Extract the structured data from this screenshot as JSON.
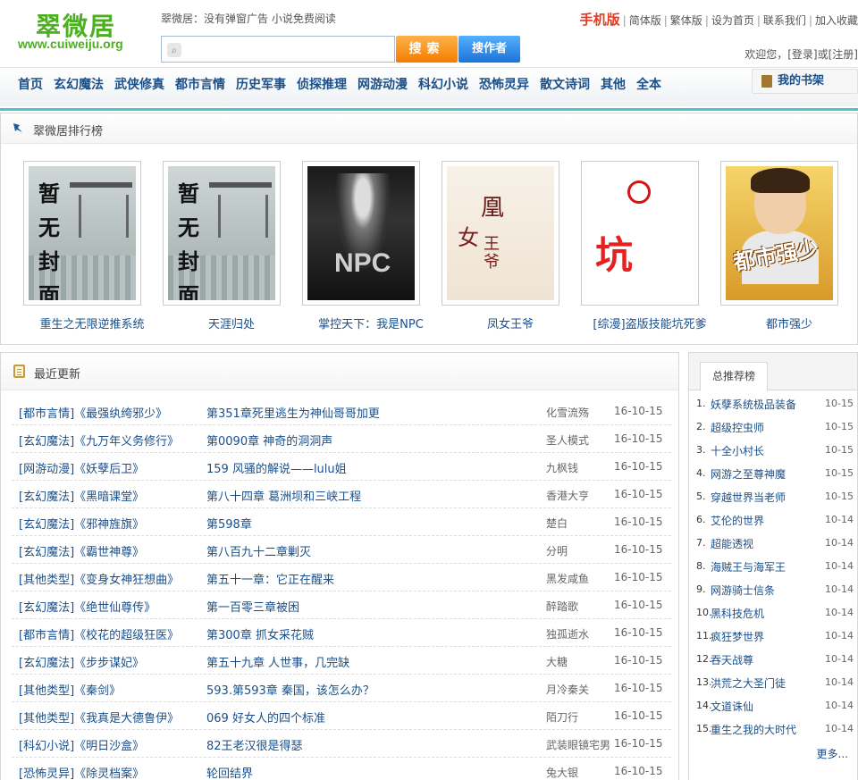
{
  "header": {
    "logo_cn": "翠微居",
    "logo_en": "www.cuiweiju.org",
    "slogan": "翠微居：没有弹窗广告 小说免费阅读",
    "search_placeholder": "",
    "search_button": "搜索",
    "author_button": "搜作者",
    "top_links": {
      "mobile": "手机版",
      "simplified": "简体版",
      "traditional": "繁体版",
      "homepage": "设为首页",
      "contact": "联系我们",
      "favorite": "加入收藏"
    },
    "welcome": "欢迎您，",
    "login": "[登录]",
    "or": "或",
    "register": "[注册]"
  },
  "nav": {
    "items": [
      "首页",
      "玄幻魔法",
      "武侠修真",
      "都市言情",
      "历史军事",
      "侦探推理",
      "网游动漫",
      "科幻小说",
      "恐怖灵异",
      "散文诗词",
      "其他",
      "全本"
    ],
    "shelf": "我的书架"
  },
  "ranking": {
    "title": "翠微居排行榜",
    "books": [
      {
        "name": "重生之无限逆推系统",
        "cover": "暂无封面"
      },
      {
        "name": "天涯归处",
        "cover": "暂无封面"
      },
      {
        "name": "掌控天下：我是NPC",
        "cover": "NPC"
      },
      {
        "name": "凤女王爷",
        "cover": "凰女王爷"
      },
      {
        "name": "[综漫]盗版技能坑死爹",
        "cover": "坑"
      },
      {
        "name": "都市强少",
        "cover": "都市强少"
      }
    ]
  },
  "recent": {
    "title": "最近更新",
    "rows": [
      {
        "cat": "[都市言情]《最强纨绔邪少》",
        "chap": "第351章死里逃生为神仙哥哥加更",
        "author": "化雪流殇",
        "date": "16-10-15"
      },
      {
        "cat": "[玄幻魔法]《九万年义务修行》",
        "chap": "第0090章 神奇的洞洞声",
        "author": "圣人模式",
        "date": "16-10-15"
      },
      {
        "cat": "[网游动漫]《妖孽后卫》",
        "chap": "159 风骚的解说——lulu姐",
        "author": "九枫钱",
        "date": "16-10-15"
      },
      {
        "cat": "[玄幻魔法]《黑暗课堂》",
        "chap": "第八十四章 葛洲坝和三峡工程",
        "author": "香港大亨",
        "date": "16-10-15"
      },
      {
        "cat": "[玄幻魔法]《邪神旌旗》",
        "chap": "第598章",
        "author": "楚白",
        "date": "16-10-15"
      },
      {
        "cat": "[玄幻魔法]《霸世神尊》",
        "chap": "第八百九十二章剿灭",
        "author": "分明",
        "date": "16-10-15"
      },
      {
        "cat": "[其他类型]《变身女神狂想曲》",
        "chap": "第五十一章：它正在醒来",
        "author": "黑发咸鱼",
        "date": "16-10-15"
      },
      {
        "cat": "[玄幻魔法]《绝世仙尊传》",
        "chap": "第一百零三章被困",
        "author": "醉踏歌",
        "date": "16-10-15"
      },
      {
        "cat": "[都市言情]《校花的超级狂医》",
        "chap": "第300章 抓女采花贼",
        "author": "独孤逝水",
        "date": "16-10-15"
      },
      {
        "cat": "[玄幻魔法]《步步谋妃》",
        "chap": "第五十九章 人世事，几完缺",
        "author": "大糖",
        "date": "16-10-15"
      },
      {
        "cat": "[其他类型]《秦剑》",
        "chap": "593.第593章 秦国，该怎么办？",
        "author": "月冷秦关",
        "date": "16-10-15"
      },
      {
        "cat": "[其他类型]《我真是大德鲁伊》",
        "chap": "069 好女人的四个标准",
        "author": "陌刀行",
        "date": "16-10-15"
      },
      {
        "cat": "[科幻小说]《明日沙盒》",
        "chap": "82王老汉很是得瑟",
        "author": "武装眼镜宅男",
        "date": "16-10-15"
      },
      {
        "cat": "[恐怖灵异]《除灵档案》",
        "chap": "轮回结界",
        "author": "兔大银",
        "date": "16-10-15"
      }
    ]
  },
  "recommend": {
    "tab": "总推荐榜",
    "items": [
      {
        "n": "1.",
        "t": "妖孽系统极品装备",
        "d": "10-15"
      },
      {
        "n": "2.",
        "t": "超级控虫师",
        "d": "10-15"
      },
      {
        "n": "3.",
        "t": "十全小村长",
        "d": "10-15"
      },
      {
        "n": "4.",
        "t": "网游之至尊神魔",
        "d": "10-15"
      },
      {
        "n": "5.",
        "t": "穿越世界当老师",
        "d": "10-15"
      },
      {
        "n": "6.",
        "t": "艾伦的世界",
        "d": "10-14"
      },
      {
        "n": "7.",
        "t": "超能透视",
        "d": "10-14"
      },
      {
        "n": "8.",
        "t": "海贼王与海军王",
        "d": "10-14"
      },
      {
        "n": "9.",
        "t": "网游骑士信条",
        "d": "10-14"
      },
      {
        "n": "10.",
        "t": "黑科技危机",
        "d": "10-14"
      },
      {
        "n": "11.",
        "t": "疯狂梦世界",
        "d": "10-14"
      },
      {
        "n": "12.",
        "t": "吞天战尊",
        "d": "10-14"
      },
      {
        "n": "13.",
        "t": "洪荒之大圣门徒",
        "d": "10-14"
      },
      {
        "n": "14.",
        "t": "文道诛仙",
        "d": "10-14"
      },
      {
        "n": "15.",
        "t": "重生之我的大时代",
        "d": "10-14"
      }
    ],
    "more": "更多..."
  }
}
